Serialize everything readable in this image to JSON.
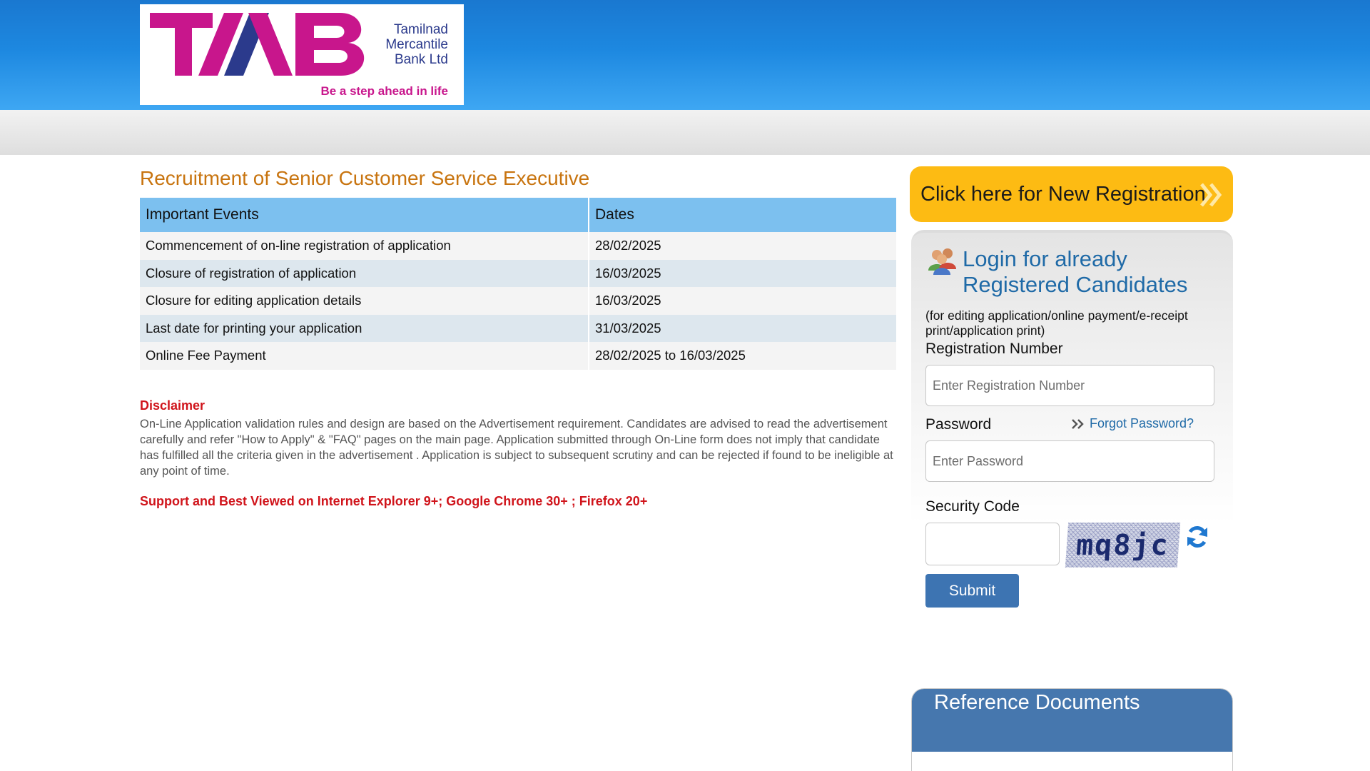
{
  "header": {
    "logo": {
      "letters": "TMB",
      "bank_name_line1": "Tamilnad",
      "bank_name_line2": "Mercantile",
      "bank_name_line3": "Bank Ltd",
      "tagline": "Be a step ahead in life"
    }
  },
  "main": {
    "title": "Recruitment of Senior Customer Service Executive",
    "events_table": {
      "headers": [
        "Important Events",
        "Dates"
      ],
      "rows": [
        {
          "event": "Commencement of on-line registration of application",
          "date": "28/02/2025"
        },
        {
          "event": "Closure of registration of application",
          "date": "16/03/2025"
        },
        {
          "event": "Closure for editing application details",
          "date": "16/03/2025"
        },
        {
          "event": "Last date for printing your application",
          "date": "31/03/2025"
        },
        {
          "event": "Online Fee Payment",
          "date": "28/02/2025 to 16/03/2025"
        }
      ]
    },
    "disclaimer": {
      "title": "Disclaimer",
      "text": "On-Line Application validation rules and design are based on the Advertisement requirement. Candidates are advised to read the advertisement carefully and refer \"How to Apply\" & \"FAQ\" pages on the main page. Application submitted through On-Line form does not imply that candidate has fulfilled all the criteria given in the advertisement . Application is subject to subsequent scrutiny and can be rejected if found to be ineligible at any point of time."
    },
    "browser_note": "Support and Best Viewed on Internet Explorer 9+; Google Chrome 30+ ; Firefox 20+"
  },
  "sidebar": {
    "new_registration_label": "Click here for New Registration",
    "login": {
      "title": "Login for already Registered Candidates",
      "subtitle": "(for editing application/online payment/e-receipt print/application print)",
      "registration_label": "Registration Number",
      "registration_placeholder": "Enter Registration Number",
      "password_label": "Password",
      "password_placeholder": "Enter Password",
      "forgot_password": "Forgot Password?",
      "security_label": "Security Code",
      "captcha_text": "mq8jc",
      "submit_label": "Submit"
    },
    "reference_documents_title": "Reference Documents"
  },
  "colors": {
    "header_blue": "#1d88e0",
    "title_orange": "#c8740f",
    "table_header": "#7cc0ef",
    "disclaimer_red": "#d0141b",
    "new_reg_yellow": "#fdbb13",
    "link_blue": "#1f6aa7",
    "submit_blue": "#3d74b2",
    "logo_magenta": "#c8168c",
    "logo_navy": "#2b3a8c"
  }
}
